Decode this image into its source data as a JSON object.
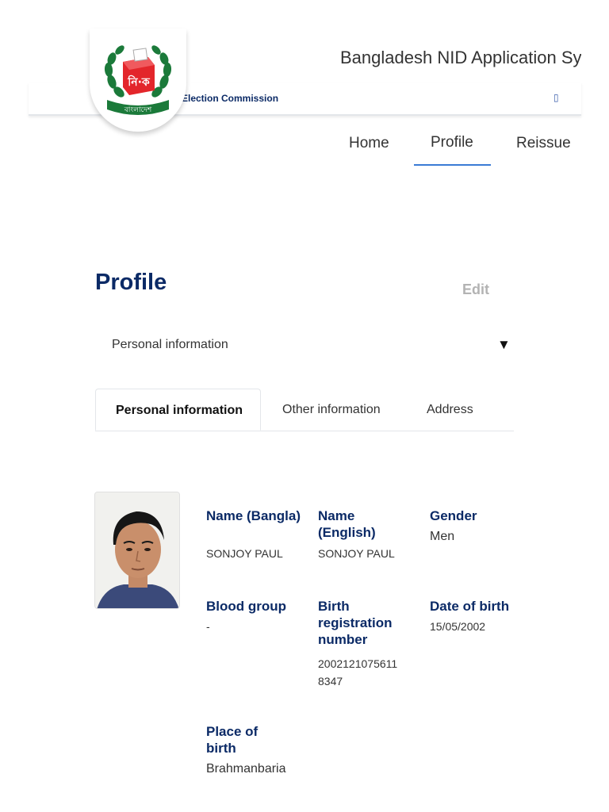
{
  "header": {
    "app_title": "Bangladesh NID Application Sy",
    "org_name": "Election Commission",
    "sub_glyph": "▯",
    "logo": {
      "text": "নি·ক",
      "band_text": "বাংলাদেশ",
      "accent_red": "#e3262b",
      "accent_green": "#1b7a3a"
    }
  },
  "nav": {
    "items": [
      {
        "label": "Home"
      },
      {
        "label": "Profile",
        "active": true
      },
      {
        "label": "Reissue"
      }
    ],
    "active_color": "#3a7bd5"
  },
  "page": {
    "title": "Profile",
    "edit_label": "Edit"
  },
  "section_select": {
    "selected": "Personal information",
    "caret": "▼"
  },
  "tabs": [
    {
      "label": "Personal information",
      "active": true
    },
    {
      "label": "Other information"
    },
    {
      "label": "Address"
    }
  ],
  "profile": {
    "fields": {
      "name_bangla": {
        "label": "Name (Bangla)",
        "value": "SONJOY PAUL"
      },
      "name_english": {
        "label": "Name (English)",
        "value": "SONJOY PAUL"
      },
      "gender": {
        "label": "Gender",
        "value": "Men"
      },
      "blood_group": {
        "label": "Blood group",
        "value": "-"
      },
      "birth_registration_number": {
        "label": "Birth registration number",
        "value": "20021210756118347"
      },
      "date_of_birth": {
        "label": "Date of birth",
        "value": "15/05/2002"
      },
      "place_of_birth": {
        "label": "Place of birth",
        "value": "Brahmanbaria"
      }
    }
  },
  "colors": {
    "title_navy": "#0b2a66",
    "edit_gray": "#b3b3b3"
  }
}
